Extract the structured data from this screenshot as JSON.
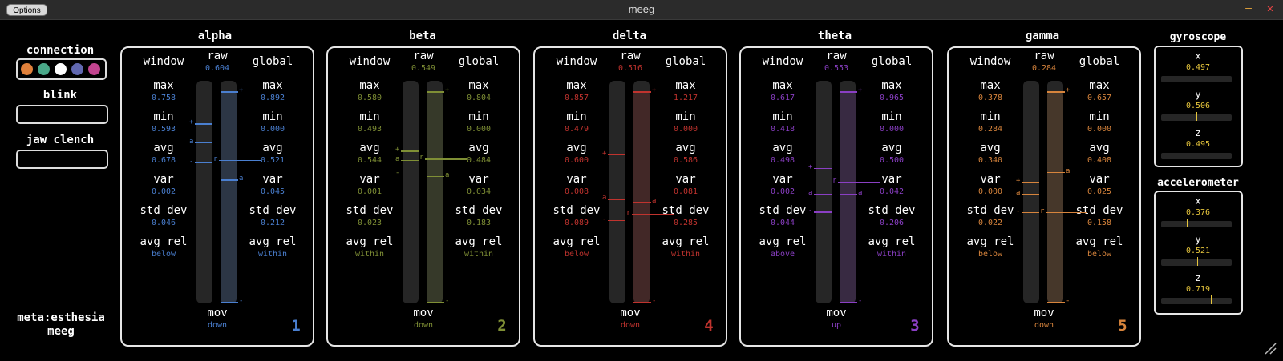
{
  "window": {
    "title": "meeg",
    "options_label": "Options",
    "minimize_glyph": "–",
    "close_glyph": "✕"
  },
  "sidebar": {
    "connection_label": "connection",
    "connection_dots": [
      "#e0803a",
      "#4aa889",
      "#ffffff",
      "#6168b0",
      "#c2448f"
    ],
    "blink_label": "blink",
    "jaw_label": "jaw clench",
    "brand_line1": "meta:esthesia",
    "brand_line2": "meeg"
  },
  "stat_labels": {
    "window": "window",
    "global": "global",
    "raw": "raw",
    "mov": "mov",
    "max": "max",
    "min": "min",
    "avg": "avg",
    "var": "var",
    "std_dev": "std dev",
    "avg_rel": "avg rel"
  },
  "bands": [
    {
      "name": "alpha",
      "color": "#4a7fd0",
      "raw": "0.604",
      "mov": "down",
      "num": "1",
      "window": {
        "max": "0.758",
        "min": "0.593",
        "avg": "0.678",
        "var": "0.002",
        "std_dev": "0.046",
        "avg_rel": "below"
      },
      "global": {
        "max": "0.892",
        "min": "0.000",
        "avg": "0.521",
        "var": "0.045",
        "std_dev": "0.212",
        "avg_rel": "within"
      }
    },
    {
      "name": "beta",
      "color": "#7f8f35",
      "raw": "0.549",
      "mov": "down",
      "num": "2",
      "window": {
        "max": "0.580",
        "min": "0.493",
        "avg": "0.544",
        "var": "0.001",
        "std_dev": "0.023",
        "avg_rel": "within"
      },
      "global": {
        "max": "0.804",
        "min": "0.000",
        "avg": "0.484",
        "var": "0.034",
        "std_dev": "0.183",
        "avg_rel": "within"
      }
    },
    {
      "name": "delta",
      "color": "#c0332e",
      "raw": "0.516",
      "mov": "down",
      "num": "4",
      "window": {
        "max": "0.857",
        "min": "0.479",
        "avg": "0.600",
        "var": "0.008",
        "std_dev": "0.089",
        "avg_rel": "below"
      },
      "global": {
        "max": "1.217",
        "min": "0.000",
        "avg": "0.586",
        "var": "0.081",
        "std_dev": "0.285",
        "avg_rel": "within"
      }
    },
    {
      "name": "theta",
      "color": "#8a3fc4",
      "raw": "0.553",
      "mov": "up",
      "num": "3",
      "window": {
        "max": "0.617",
        "min": "0.418",
        "avg": "0.498",
        "var": "0.002",
        "std_dev": "0.044",
        "avg_rel": "above"
      },
      "global": {
        "max": "0.965",
        "min": "0.000",
        "avg": "0.500",
        "var": "0.042",
        "std_dev": "0.206",
        "avg_rel": "within"
      }
    },
    {
      "name": "gamma",
      "color": "#d7843c",
      "raw": "0.284",
      "mov": "down",
      "num": "5",
      "window": {
        "max": "0.378",
        "min": "0.284",
        "avg": "0.340",
        "var": "0.000",
        "std_dev": "0.022",
        "avg_rel": "below"
      },
      "global": {
        "max": "0.657",
        "min": "0.000",
        "avg": "0.408",
        "var": "0.025",
        "std_dev": "0.158",
        "avg_rel": "below"
      }
    }
  ],
  "gyroscope": {
    "title": "gyroscope",
    "axes": [
      {
        "label": "x",
        "value": "0.497"
      },
      {
        "label": "y",
        "value": "0.506"
      },
      {
        "label": "z",
        "value": "0.495"
      }
    ]
  },
  "accelerometer": {
    "title": "accelerometer",
    "axes": [
      {
        "label": "x",
        "value": "0.376"
      },
      {
        "label": "y",
        "value": "0.521"
      },
      {
        "label": "z",
        "value": "0.719"
      }
    ]
  }
}
